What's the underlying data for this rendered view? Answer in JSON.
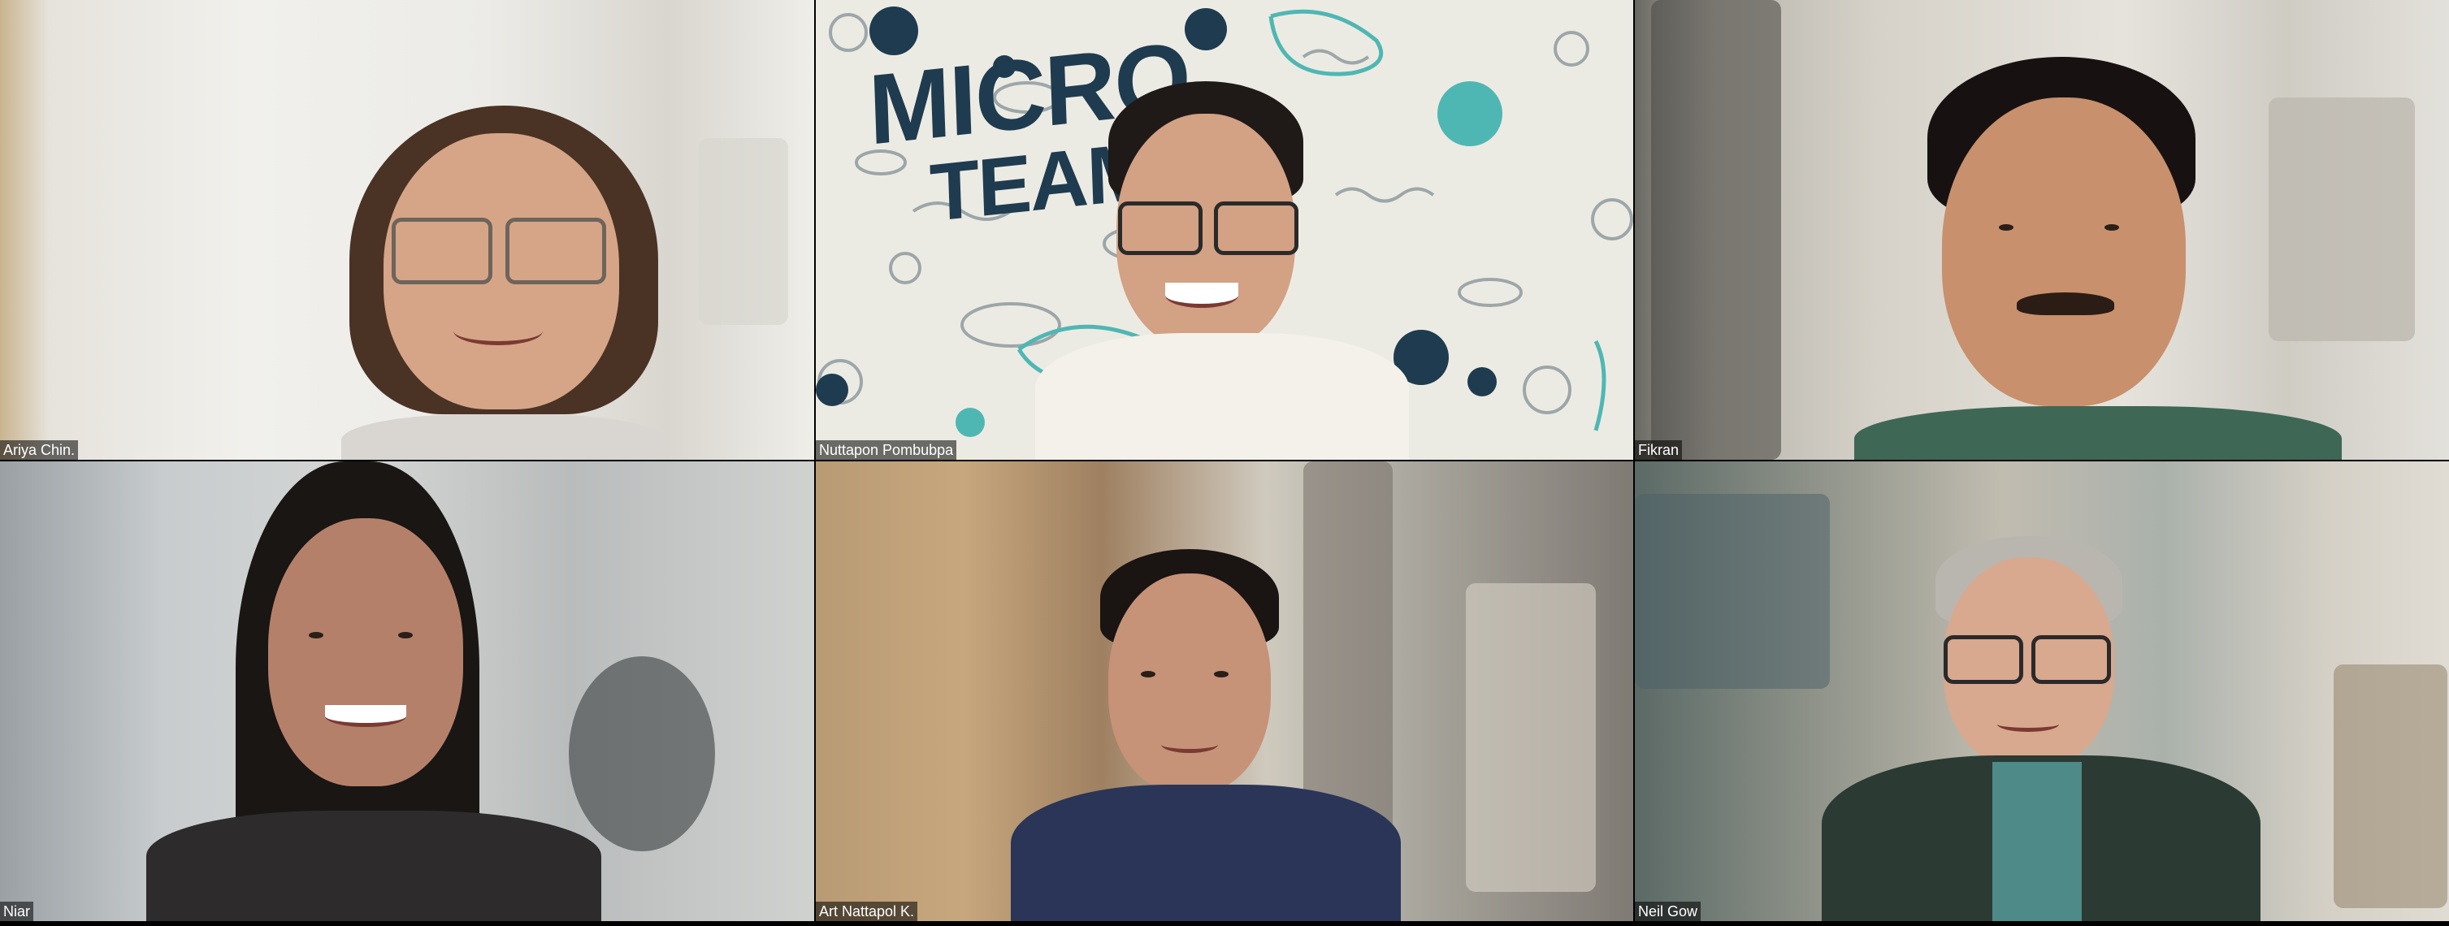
{
  "meeting": {
    "participants": [
      {
        "name": "Ariya Chin."
      },
      {
        "name": "Nuttapon Pombubpa",
        "background_text_line1": "MICRO",
        "background_text_line2": "TEAM"
      },
      {
        "name": "Fikran"
      },
      {
        "name": "Niar"
      },
      {
        "name": "Art Nattapol K."
      },
      {
        "name": "Neil Gow"
      }
    ]
  },
  "colors": {
    "label_bg": "#000000",
    "label_text": "#ffffff",
    "micro_team_text": "#1f3b4f",
    "germ_teal": "#4fb7b3",
    "germ_navy": "#1f3b4f"
  }
}
